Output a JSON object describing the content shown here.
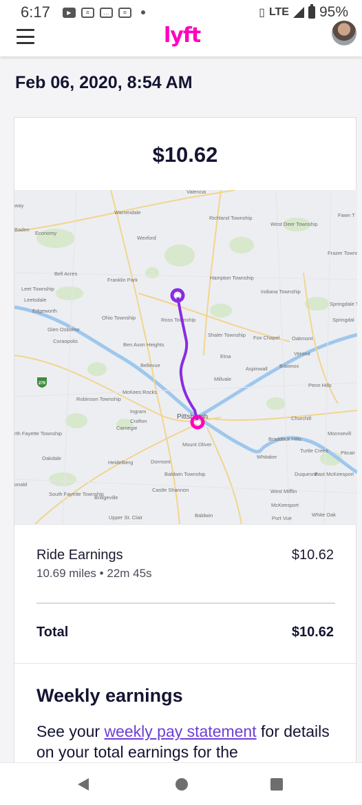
{
  "status_bar": {
    "time": "6:17",
    "network": "LTE",
    "battery": "95%"
  },
  "app": {
    "logo_text": "lyft",
    "brand_color": "#ff00bf"
  },
  "ride": {
    "date": "Feb 06, 2020, 8:54 AM",
    "amount": "$10.62",
    "earnings_label": "Ride Earnings",
    "earnings_amount": "$10.62",
    "distance": "10.69 miles",
    "separator": "•",
    "duration": "22m 45s",
    "total_label": "Total",
    "total_amount": "$10.62"
  },
  "map": {
    "route_color": "#8a2be2",
    "pickup_color": "#8a2be2",
    "dropoff_color": "#ff00bf",
    "labels": [
      "Valencia",
      "Warrendale",
      "Richland Township",
      "West Deer Township",
      "Fawn T",
      "Baden",
      "Economy",
      "Wexford",
      "Frazer Township",
      "Bell Acres",
      "Franklin Park",
      "Hampton Township",
      "Indiana Township",
      "Leet Township",
      "Leetsdale",
      "Edgeworth",
      "Springdale Township",
      "Springdal",
      "Ohio Township",
      "Ross Township",
      "Shaler Township",
      "Fox Chapel",
      "Oakmont",
      "Glen Osborne",
      "Coraopolis",
      "Ben Avon Heights",
      "Etna",
      "Verona",
      "Bellevue",
      "Aspinwall",
      "Blawnox",
      "Millvale",
      "Penn Hills",
      "Robinson Township",
      "McKees Rocks",
      "Ingram",
      "Crafton",
      "Pittsburgh",
      "Churchill",
      "rth Fayette Township",
      "Carnegie",
      "Mount Oliver",
      "Braddock Hills",
      "Monroevill",
      "Oakdale",
      "Heidelberg",
      "Dormont",
      "Turtle Creek",
      "Pitcair",
      "Whitaker",
      "Baldwin Township",
      "Duquesne",
      "East McKeesport",
      "onald",
      "Castle Shannon",
      "West Mifflin",
      "South Fayette Township",
      "Bridgeville",
      "McKeesport",
      "Upper St. Clair",
      "Baldwin",
      "Port Vue",
      "White Oak",
      "way",
      "279"
    ]
  },
  "weekly": {
    "title": "Weekly earnings",
    "text_before": "See your ",
    "link": "weekly pay statement",
    "text_after": " for details on your total earnings for the"
  }
}
